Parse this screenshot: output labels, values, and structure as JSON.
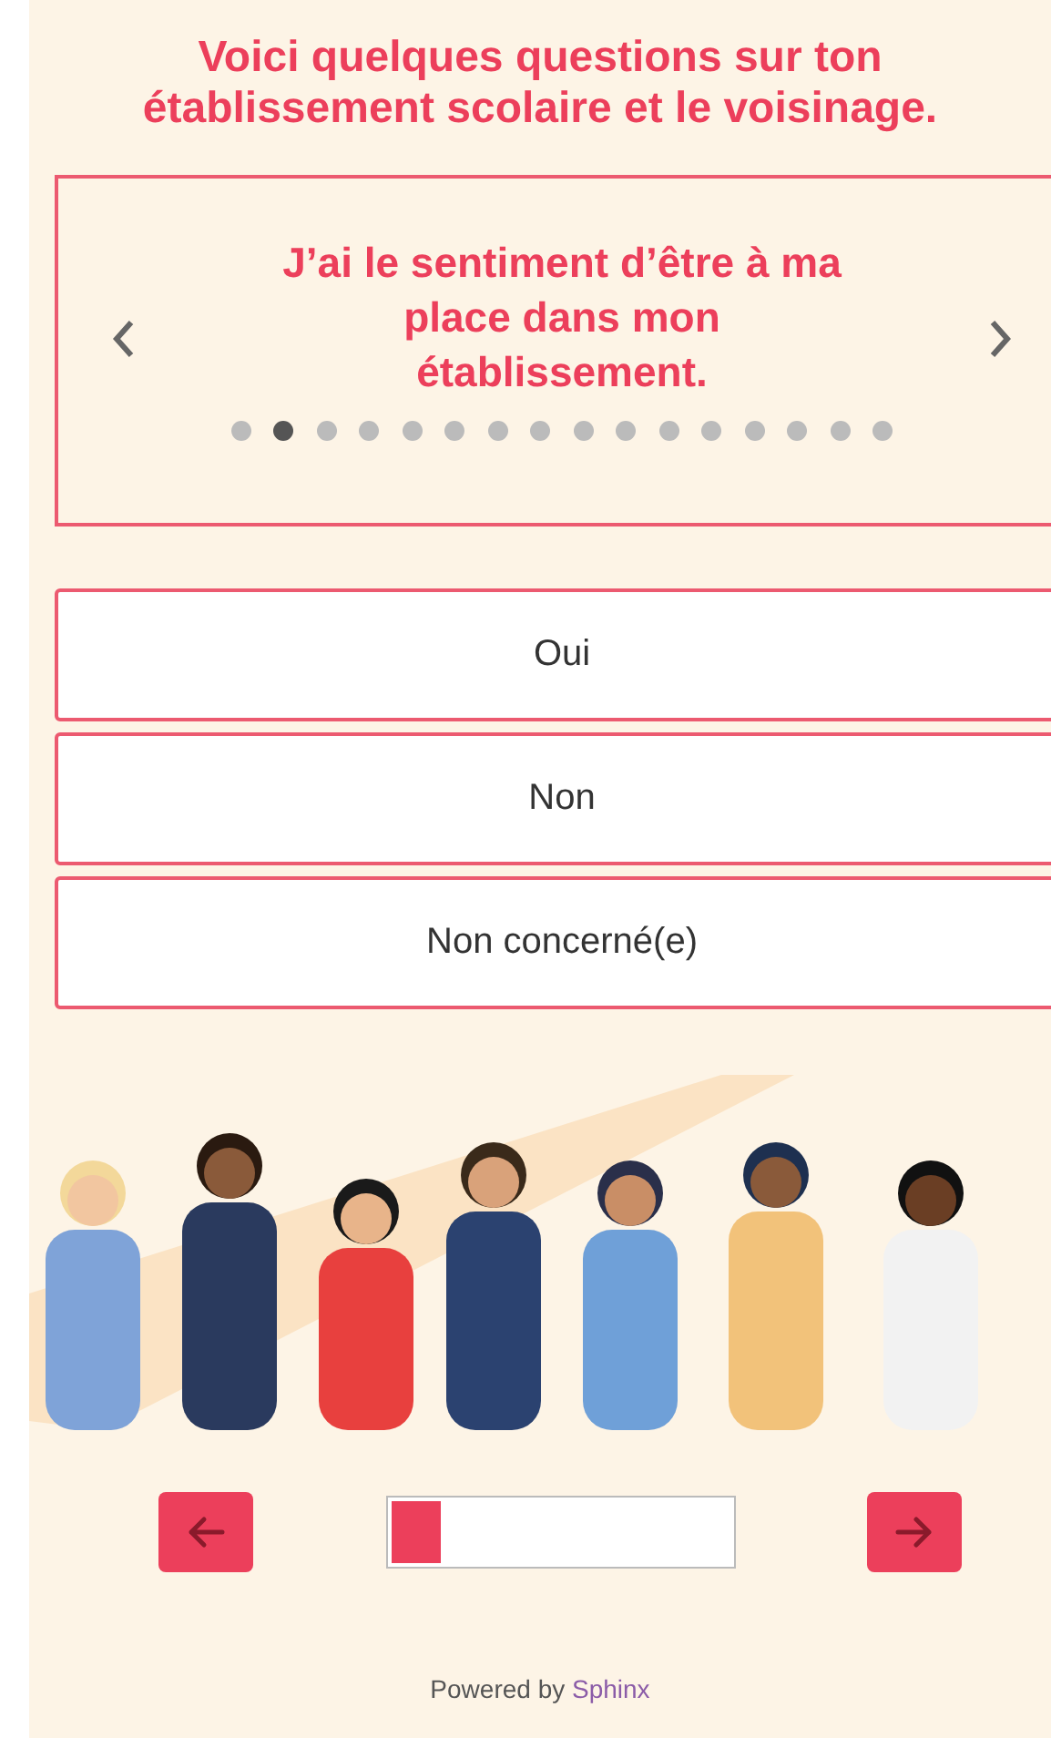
{
  "heading": "Voici quelques questions sur ton établissement scolaire et le voisinage.",
  "carousel": {
    "question": "J’ai le sentiment d’être à ma place dans mon établissement.",
    "dots": [
      {
        "selected": false
      },
      {
        "selected": true
      },
      {
        "selected": false
      },
      {
        "selected": false
      },
      {
        "selected": false
      },
      {
        "selected": false
      },
      {
        "selected": false
      },
      {
        "selected": false
      },
      {
        "selected": false
      },
      {
        "selected": false
      },
      {
        "selected": false
      },
      {
        "selected": false
      },
      {
        "selected": false
      },
      {
        "selected": false
      },
      {
        "selected": false
      },
      {
        "selected": false
      }
    ]
  },
  "answers": [
    {
      "label": "Oui"
    },
    {
      "label": "Non"
    },
    {
      "label": "Non concerné(e)"
    }
  ],
  "progress": {
    "level": 0.15
  },
  "footer": {
    "text": "Powered by",
    "brand": "Sphinx"
  }
}
